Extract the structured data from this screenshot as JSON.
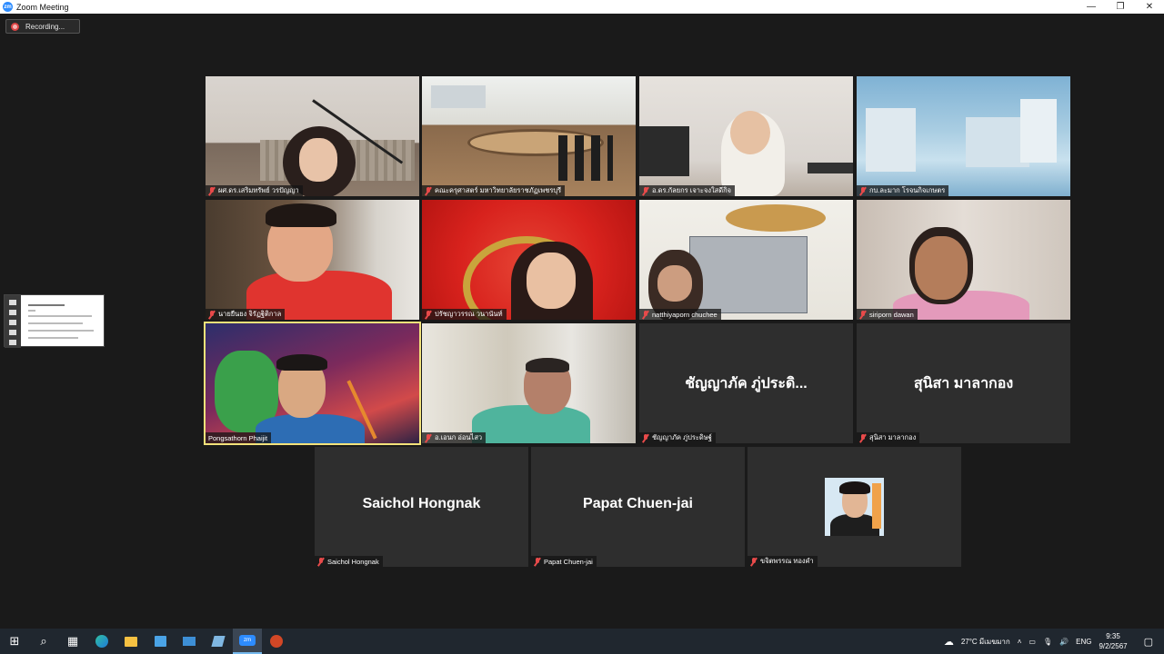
{
  "window": {
    "title": "Zoom Meeting",
    "controls": [
      "—",
      "❐",
      "✕"
    ]
  },
  "recording": {
    "label": "Recording..."
  },
  "tiles": [
    {
      "name": "ผศ.ดร.เสริมทรัพย์ วรปัญญา",
      "muted": true
    },
    {
      "name": "คณะครุศาสตร์ มหาวิทยาลัยราชภัฏเพชรบุรี",
      "muted": true
    },
    {
      "name": "อ.ดร.กัลยกร เจาะจงใสดีกิจ",
      "muted": true
    },
    {
      "name": "กบ.ละมาก โรจนกิจเกษตร",
      "muted": true
    },
    {
      "name": "นายยืนยง จิรัฏฐิติกาล",
      "muted": true
    },
    {
      "name": "ปรัชญาวรรณ วนานันท์",
      "muted": true
    },
    {
      "name": "natthiyaporn chuchee",
      "muted": true
    },
    {
      "name": "siriporn dawan",
      "muted": true
    },
    {
      "name": "Pongsathorn Phaijit",
      "muted": false,
      "active": true
    },
    {
      "name": "อ.เอนก อ่อนไสว",
      "muted": true
    },
    {
      "name": "ชัญญาภัค ภู่ประดิษฐ์",
      "muted": true,
      "display_name": "ชัญญาภัค ภู่ประดิ..."
    },
    {
      "name": "สุนิสา มาลากอง",
      "muted": true,
      "display_name": "สุนิสา มาลากอง"
    },
    {
      "name": "Saichol Hongnak",
      "muted": true,
      "display_name": "Saichol Hongnak"
    },
    {
      "name": "Papat Chuen-jai",
      "muted": true,
      "display_name": "Papat Chuen-jai"
    },
    {
      "name": "ขจิตพรรณ ทองคำ",
      "muted": true
    }
  ],
  "taskbar": {
    "icons": [
      "windows-start",
      "search",
      "task-view",
      "edge",
      "file-explorer",
      "store",
      "mail",
      "app",
      "zoom",
      "powerpoint"
    ],
    "weather": "27°C มีเมฆมาก",
    "language": "ENG",
    "time": "9:35",
    "date": "9/2/2567"
  },
  "colors": {
    "background": "#1a1a1a",
    "active_speaker": "#f3e27a",
    "muted_icon": "#e84a4a",
    "taskbar": "#20272f"
  }
}
